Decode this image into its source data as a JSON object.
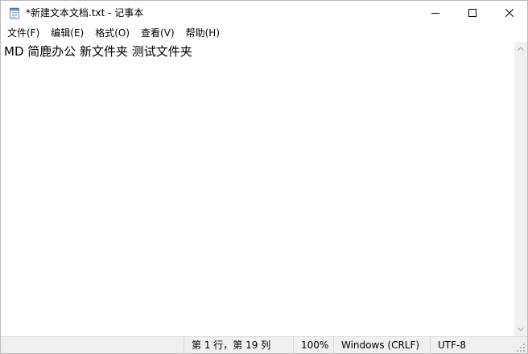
{
  "window": {
    "title": "*新建文本文档.txt - 记事本"
  },
  "icons": {
    "app": "notepad-icon",
    "minimize": "minimize-icon",
    "maximize": "maximize-icon",
    "close": "close-icon"
  },
  "menu": {
    "items": [
      {
        "label": "文件(F)"
      },
      {
        "label": "编辑(E)"
      },
      {
        "label": "格式(O)"
      },
      {
        "label": "查看(V)"
      },
      {
        "label": "帮助(H)"
      }
    ]
  },
  "editor": {
    "content": "MD 简鹿办公 新文件夹 测试文件夹"
  },
  "status": {
    "position": "第 1 行，第 19 列",
    "zoom": "100%",
    "line_ending": "Windows (CRLF)",
    "encoding": "UTF-8"
  },
  "colors": {
    "background": "#ffffff",
    "statusbar": "#f0f0f0",
    "border": "#d7d7d7"
  }
}
